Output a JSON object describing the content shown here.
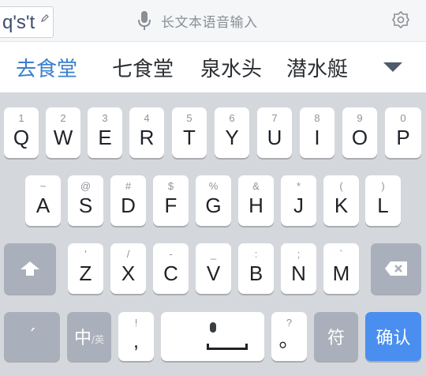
{
  "composition": {
    "text": "q's't"
  },
  "voice": {
    "label": "长文本语音输入",
    "icon": "microphone-icon"
  },
  "settings": {
    "icon": "gear-icon"
  },
  "candidates": [
    "去食堂",
    "七食堂",
    "泉水头",
    "潜水艇"
  ],
  "expand": {
    "icon": "triangle-down-icon"
  },
  "rows": {
    "row1": [
      {
        "alt": "1",
        "main": "Q"
      },
      {
        "alt": "2",
        "main": "W"
      },
      {
        "alt": "3",
        "main": "E"
      },
      {
        "alt": "4",
        "main": "R"
      },
      {
        "alt": "5",
        "main": "T"
      },
      {
        "alt": "6",
        "main": "Y"
      },
      {
        "alt": "7",
        "main": "U"
      },
      {
        "alt": "8",
        "main": "I"
      },
      {
        "alt": "9",
        "main": "O"
      },
      {
        "alt": "0",
        "main": "P"
      }
    ],
    "row2": [
      {
        "alt": "~",
        "main": "A"
      },
      {
        "alt": "@",
        "main": "S"
      },
      {
        "alt": "#",
        "main": "D"
      },
      {
        "alt": "$",
        "main": "F"
      },
      {
        "alt": "%",
        "main": "G"
      },
      {
        "alt": "&",
        "main": "H"
      },
      {
        "alt": "*",
        "main": "J"
      },
      {
        "alt": "(",
        "main": "K"
      },
      {
        "alt": ")",
        "main": "L"
      }
    ],
    "row3": [
      {
        "alt": "'",
        "main": "Z"
      },
      {
        "alt": "/",
        "main": "X"
      },
      {
        "alt": "-",
        "main": "C"
      },
      {
        "alt": "_",
        "main": "V"
      },
      {
        "alt": ":",
        "main": "B"
      },
      {
        "alt": ";",
        "main": "N"
      },
      {
        "alt": "`",
        "main": "M"
      }
    ]
  },
  "bottom": {
    "apostrophe": "ˊ",
    "lang_main": "中",
    "lang_sub": "/英",
    "comma_alt": "!",
    "comma": ",",
    "period_alt": "?",
    "period": "。",
    "symbols": "符",
    "confirm": "确认"
  },
  "colors": {
    "accent": "#3a7fd0",
    "confirm_key": "#4a8ef0",
    "function_key": "#aab0bb"
  }
}
